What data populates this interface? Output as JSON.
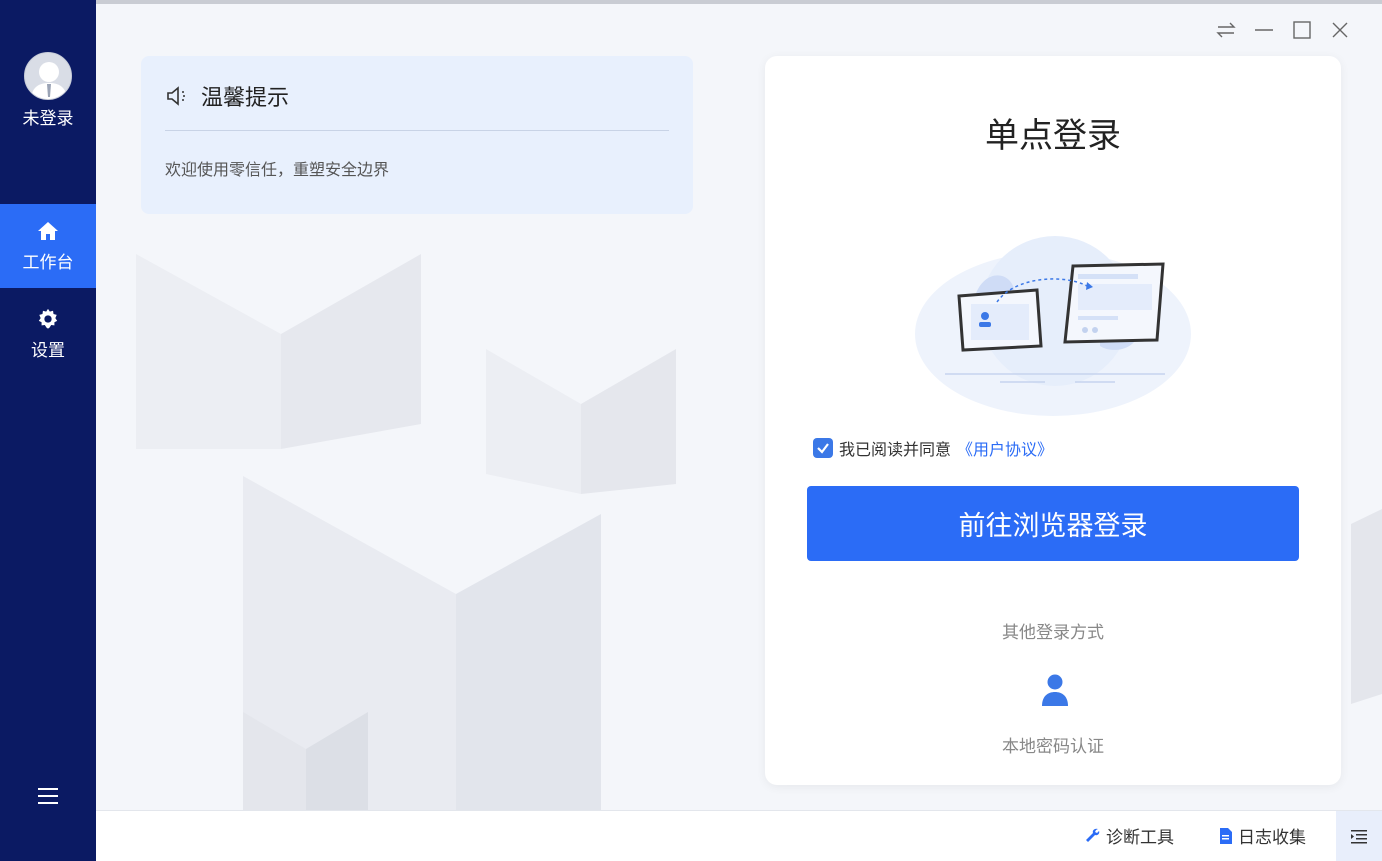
{
  "sidebar": {
    "user_label": "未登录",
    "items": [
      {
        "label": "工作台",
        "icon": "home-icon",
        "active": true
      },
      {
        "label": "设置",
        "icon": "gear-icon",
        "active": false
      }
    ],
    "menu_icon": "hamburger-icon"
  },
  "window_controls": [
    "swap-icon",
    "minimize-icon",
    "maximize-icon",
    "close-icon"
  ],
  "notice": {
    "icon": "speaker-icon",
    "title": "温馨提示",
    "text": "欢迎使用零信任，重塑安全边界"
  },
  "login": {
    "title": "单点登录",
    "agree_text": "我已阅读并同意",
    "agree_link": "《用户协议》",
    "agree_checked": true,
    "primary_button": "前往浏览器登录",
    "other_label": "其他登录方式",
    "local_label": "本地密码认证"
  },
  "footer": {
    "diagnose": "诊断工具",
    "logs": "日志收集"
  },
  "colors": {
    "sidebar": "#0b1a63",
    "accent": "#2b6cf6",
    "notice_bg": "#e8f0fd",
    "main_bg": "#f4f6fa"
  }
}
